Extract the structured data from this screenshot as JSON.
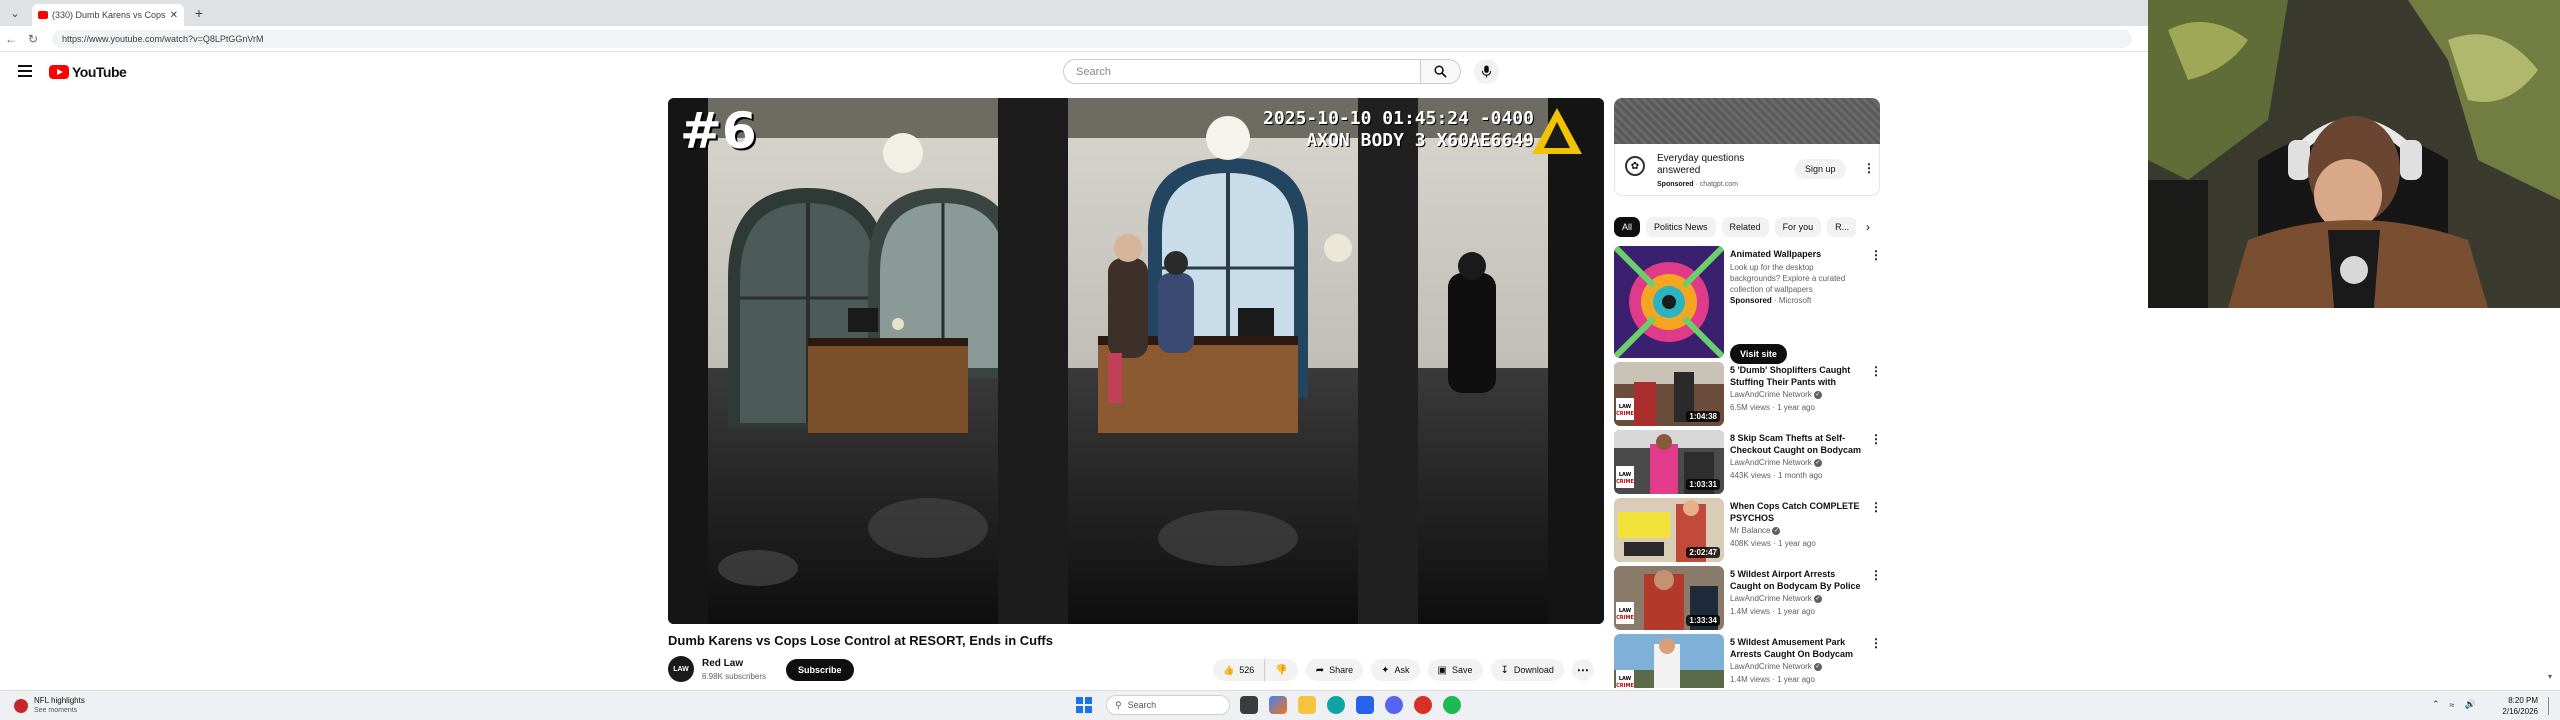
{
  "browser": {
    "tab_title": "(330) Dumb Karens vs Cops L...",
    "url": "https://www.youtube.com/watch?v=Q8LPtGGnVrM"
  },
  "youtube": {
    "logo_text": "YouTube",
    "search_placeholder": "Search"
  },
  "video": {
    "overlay_number": "#6",
    "overlay_timestamp": "2025-10-10 01:45:24 -0400",
    "overlay_device": "AXON BODY 3 X60AE6649",
    "title": "Dumb Karens vs Cops Lose Control at RESORT, Ends in Cuffs",
    "channel_name": "Red Law",
    "channel_avatar_text": "LAW",
    "channel_subs": "6.98K subscribers",
    "subscribe_label": "Subscribe",
    "like_count": "526",
    "share_label": "Share",
    "ask_label": "Ask",
    "save_label": "Save",
    "download_label": "Download"
  },
  "ad": {
    "title": "Everyday questions answered",
    "sponsored": "Sponsored",
    "domain": "chatgpt.com",
    "cta": "Sign up"
  },
  "chips": [
    "All",
    "Politics News",
    "Related",
    "For you",
    "R..."
  ],
  "recommendations": [
    {
      "title": "Animated Wallpapers",
      "desc": "Look up for the desktop backgrounds? Explore a curated collection of wallpapers",
      "sponsored": "Sponsored",
      "advertiser": "Microsoft",
      "cta": "Visit site"
    },
    {
      "title": "5 'Dumb' Shoplifters Caught Stuffing Their Pants with Stole...",
      "channel": "LawAndCrime Network",
      "meta": "6.5M views · 1 year ago",
      "duration": "1:04:38"
    },
    {
      "title": "8 Skip Scam Thefts at Self-Checkout Caught on Bodycam",
      "channel": "LawAndCrime Network",
      "meta": "443K views · 1 month ago",
      "duration": "1:03:31"
    },
    {
      "title": "When Cops Catch COMPLETE PSYCHOS",
      "channel": "Mr Balance",
      "meta": "408K views · 1 year ago",
      "duration": "2:02:47"
    },
    {
      "title": "5 Wildest Airport Arrests Caught on Bodycam By Police",
      "channel": "LawAndCrime Network",
      "meta": "1.4M views · 1 year ago",
      "duration": "1:33:34"
    },
    {
      "title": "5 Wildest Amusement Park Arrests Caught On Bodycam",
      "channel": "LawAndCrime Network",
      "meta": "1.4M views · 1 year ago",
      "duration": ""
    }
  ],
  "taskbar": {
    "news_title": "NFL highlights",
    "news_sub": "See moments",
    "search_label": "Search",
    "time": "8:20 PM",
    "date": "2/16/2026"
  }
}
